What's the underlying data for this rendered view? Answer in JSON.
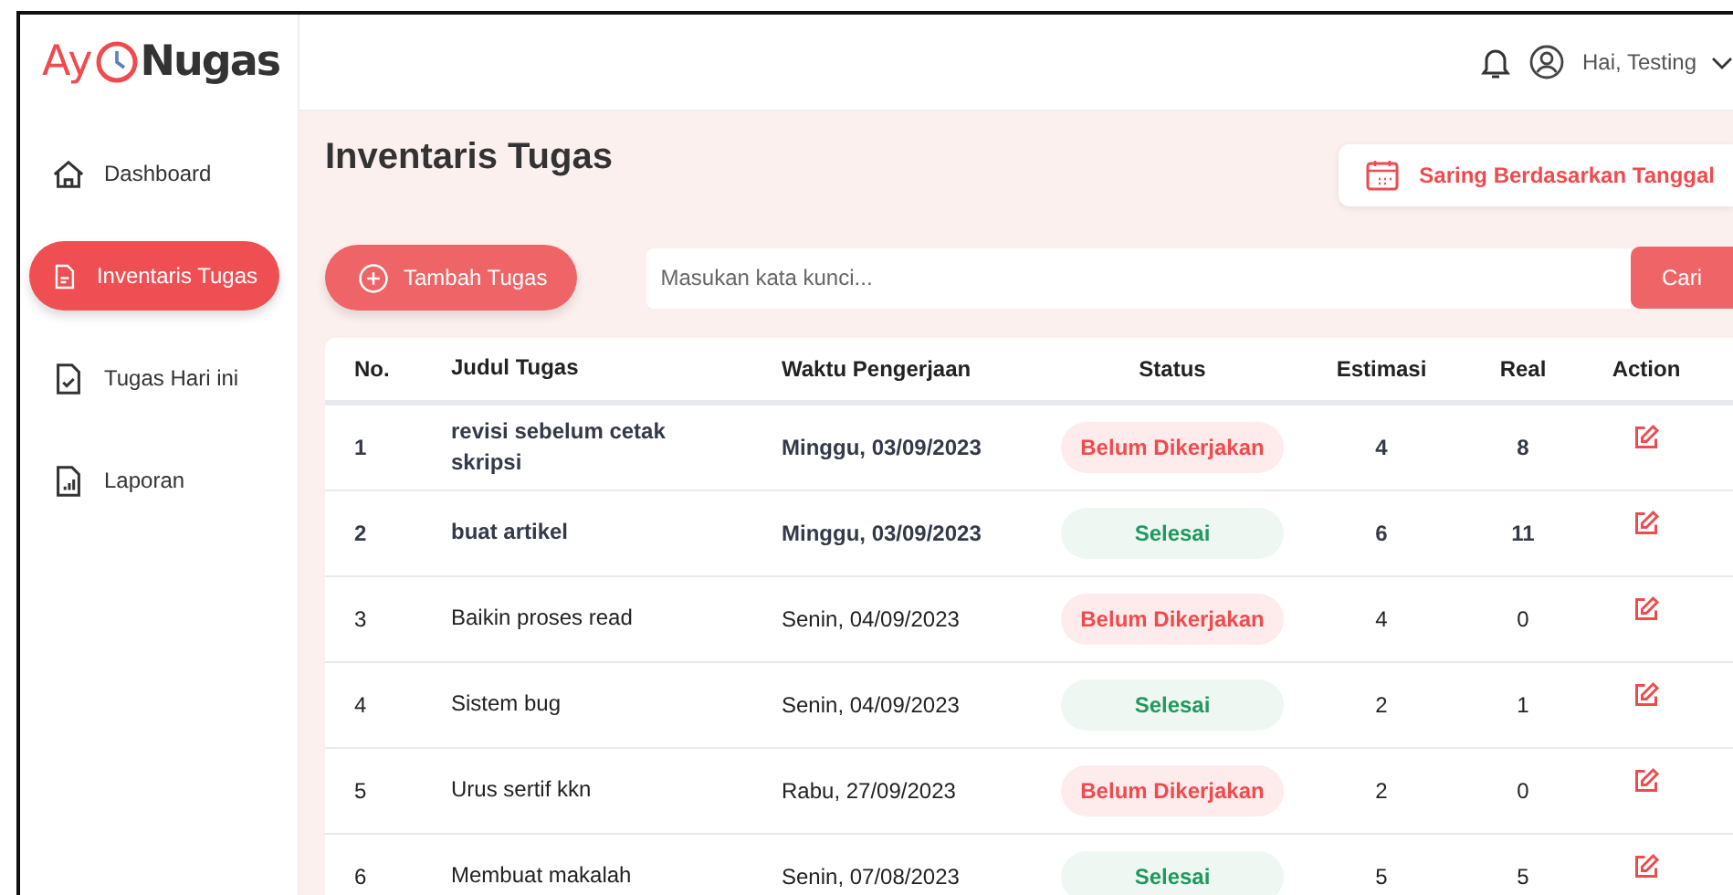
{
  "logo": {
    "prefix": "Ay",
    "suffix": "Nugas"
  },
  "header": {
    "greeting": "Hai, Testing"
  },
  "sidebar": {
    "items": [
      {
        "label": "Dashboard",
        "kind": "home",
        "selected": false
      },
      {
        "label": "Inventaris Tugas",
        "kind": "doc",
        "selected": true
      },
      {
        "label": "Tugas Hari ini",
        "kind": "check",
        "selected": false
      },
      {
        "label": "Laporan",
        "kind": "report",
        "selected": false
      }
    ]
  },
  "page": {
    "title": "Inventaris Tugas",
    "filter_button": "Saring Berdasarkan Tanggal",
    "add_button": "Tambah Tugas",
    "search": {
      "placeholder": "Masukan kata kunci..."
    },
    "search_button": "Cari"
  },
  "table": {
    "columns": [
      "No.",
      "Judul Tugas",
      "Waktu Pengerjaan",
      "Status",
      "Estimasi",
      "Real",
      "Action"
    ],
    "rows": [
      {
        "no": "1",
        "title": "revisi sebelum cetak skripsi",
        "time": "Minggu, 03/09/2023",
        "status": "Belum Dikerjakan",
        "kind": "pending",
        "emphasized": true,
        "estimate": "4",
        "real": "8"
      },
      {
        "no": "2",
        "title": "buat artikel",
        "time": "Minggu, 03/09/2023",
        "status": "Selesai",
        "kind": "done",
        "emphasized": true,
        "estimate": "6",
        "real": "11"
      },
      {
        "no": "3",
        "title": "Baikin proses read",
        "time": "Senin, 04/09/2023",
        "status": "Belum Dikerjakan",
        "kind": "pending",
        "emphasized": false,
        "estimate": "4",
        "real": "0"
      },
      {
        "no": "4",
        "title": "Sistem bug",
        "time": "Senin, 04/09/2023",
        "status": "Selesai",
        "kind": "done",
        "emphasized": false,
        "estimate": "2",
        "real": "1"
      },
      {
        "no": "5",
        "title": "Urus sertif kkn",
        "time": "Rabu, 27/09/2023",
        "status": "Belum Dikerjakan",
        "kind": "pending",
        "emphasized": false,
        "estimate": "2",
        "real": "0"
      },
      {
        "no": "6",
        "title": "Membuat makalah",
        "time": "Senin, 07/08/2023",
        "status": "Selesai",
        "kind": "done",
        "emphasized": false,
        "estimate": "5",
        "real": "5"
      }
    ]
  }
}
